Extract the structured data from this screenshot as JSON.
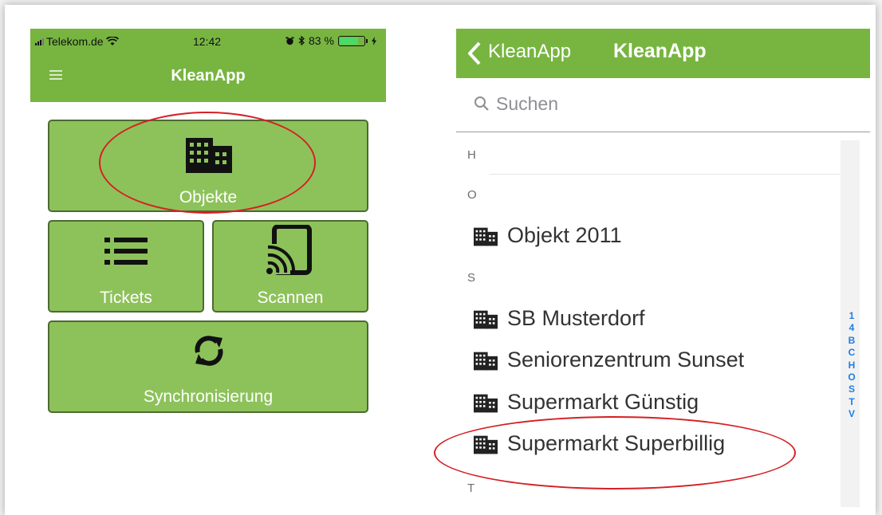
{
  "left_phone": {
    "status_bar": {
      "carrier": "Telekom.de",
      "time": "12:42",
      "battery_percent": "83 %",
      "battery_level": 0.83
    },
    "header": {
      "title": "KleanApp",
      "menu_icon": "hamburger-icon"
    },
    "tiles": {
      "objekte": {
        "label": "Objekte",
        "icon": "building-icon"
      },
      "tickets": {
        "label": "Tickets",
        "icon": "list-icon"
      },
      "scannen": {
        "label": "Scannen",
        "icon": "nfc-scan-icon"
      },
      "sync": {
        "label": "Synchronisierung",
        "icon": "sync-icon"
      }
    }
  },
  "right_phone": {
    "header": {
      "back_label": "KleanApp",
      "title": "KleanApp"
    },
    "search": {
      "placeholder": "Suchen"
    },
    "sections": {
      "h": {
        "header": "H"
      },
      "o": {
        "header": "O",
        "items": [
          "Objekt 2011"
        ]
      },
      "s": {
        "header": "S",
        "items": [
          "SB Musterdorf",
          "Seniorenzentrum Sunset",
          "Supermarkt Günstig",
          "Supermarkt Superbillig"
        ]
      },
      "t": {
        "header": "T"
      }
    },
    "index": [
      "1",
      "4",
      "B",
      "C",
      "H",
      "O",
      "S",
      "T",
      "V"
    ]
  },
  "colors": {
    "header_green": "#77b540",
    "tile_green": "#8dc25a",
    "highlight_red": "#d62024",
    "index_blue": "#1e7ee4"
  }
}
